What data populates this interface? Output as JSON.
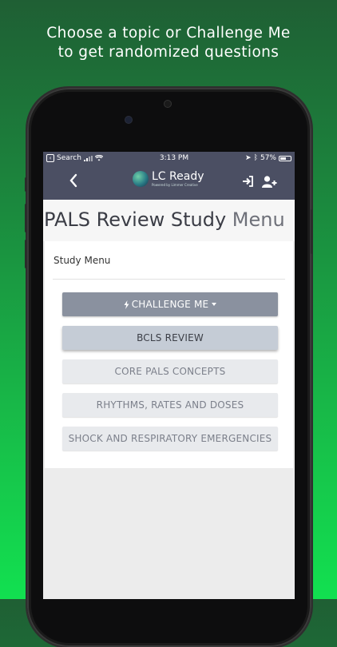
{
  "caption": {
    "line1": "Choose a topic or Challenge Me",
    "line2": "to get randomized questions"
  },
  "status_bar": {
    "back_app": "Search",
    "time": "3:13 PM",
    "battery": "57%",
    "battery_level": 0.57
  },
  "nav": {
    "logo_text": "LC Ready",
    "logo_subtext": "Powered by Limmer Creative",
    "icons": [
      "chevron-left-icon",
      "sign-in-icon",
      "add-user-icon"
    ]
  },
  "page": {
    "title_main": "PALS Review Study",
    "title_tail": "Menu",
    "section_label": "Study Menu"
  },
  "menu": {
    "challenge_label": "CHALLENGE ME",
    "items": [
      {
        "label": "BCLS REVIEW"
      },
      {
        "label": "CORE PALS CONCEPTS"
      },
      {
        "label": "RHYTHMS, RATES AND DOSES"
      },
      {
        "label": "SHOCK AND RESPIRATORY EMERGENCIES"
      }
    ]
  },
  "colors": {
    "navbar": "#4b4f63",
    "challenge_button": "#8a919f",
    "active_button": "#c5ccd6",
    "background_gradient_top": "#1f5f34",
    "background_gradient_bottom": "#12e050"
  }
}
